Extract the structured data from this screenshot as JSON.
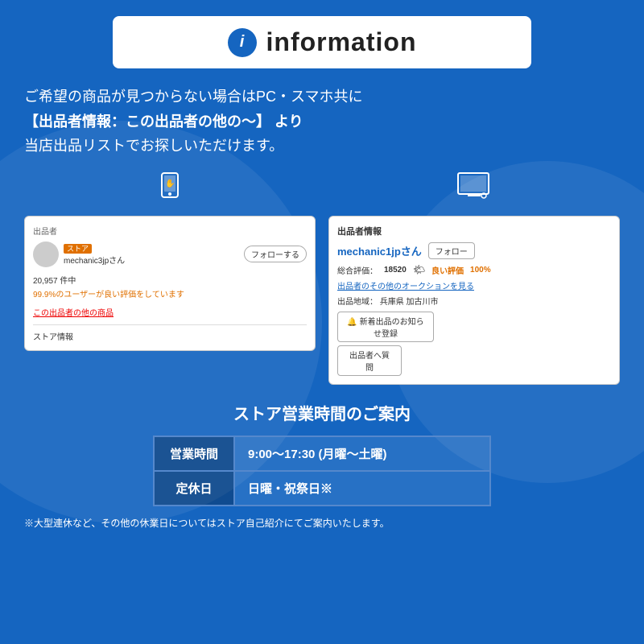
{
  "header": {
    "icon_label": "i",
    "title": "information"
  },
  "intro": {
    "line1": "ご希望の商品が見つからない場合はPC・スマホ共に",
    "line2": "【出品者情報：この出品者の他の〜】 より",
    "line3": "当店出品リストでお探しいただけます。"
  },
  "mobile_screenshot": {
    "seller_label": "出品者",
    "store_badge": "ストア",
    "seller_name": "mechanic3jpさん",
    "follow_button": "フォローする",
    "review_count": "20,957 件中",
    "review_percent": "99.9%のユーザーが良い評価をしています",
    "other_items_link": "この出品者の他の商品",
    "store_info": "ストア情報"
  },
  "desktop_screenshot": {
    "title": "出品者情報",
    "seller_name": "mechanic1jpさん",
    "follow_button": "フォロー",
    "rating_label": "総合評価：",
    "rating_number": "18520",
    "good_label": "良い評価",
    "good_percent": "100%",
    "auction_link": "出品者のその他のオークションを見る",
    "location_label": "出品地域：",
    "location_value": "兵庫県 加古川市",
    "notify_button": "🔔 新着出品のお知らせ登録",
    "question_button": "出品者へ質問"
  },
  "store_hours": {
    "title": "ストア営業時間のご案内",
    "rows": [
      {
        "label": "営業時間",
        "value": "9:00〜17:30 (月曜〜土曜)"
      },
      {
        "label": "定休日",
        "value": "日曜・祝祭日※"
      }
    ],
    "note": "※大型連休など、その他の休業日についてはストア自己紹介にてご案内いたします。"
  },
  "icons": {
    "mobile": "📱",
    "desktop": "💻"
  }
}
